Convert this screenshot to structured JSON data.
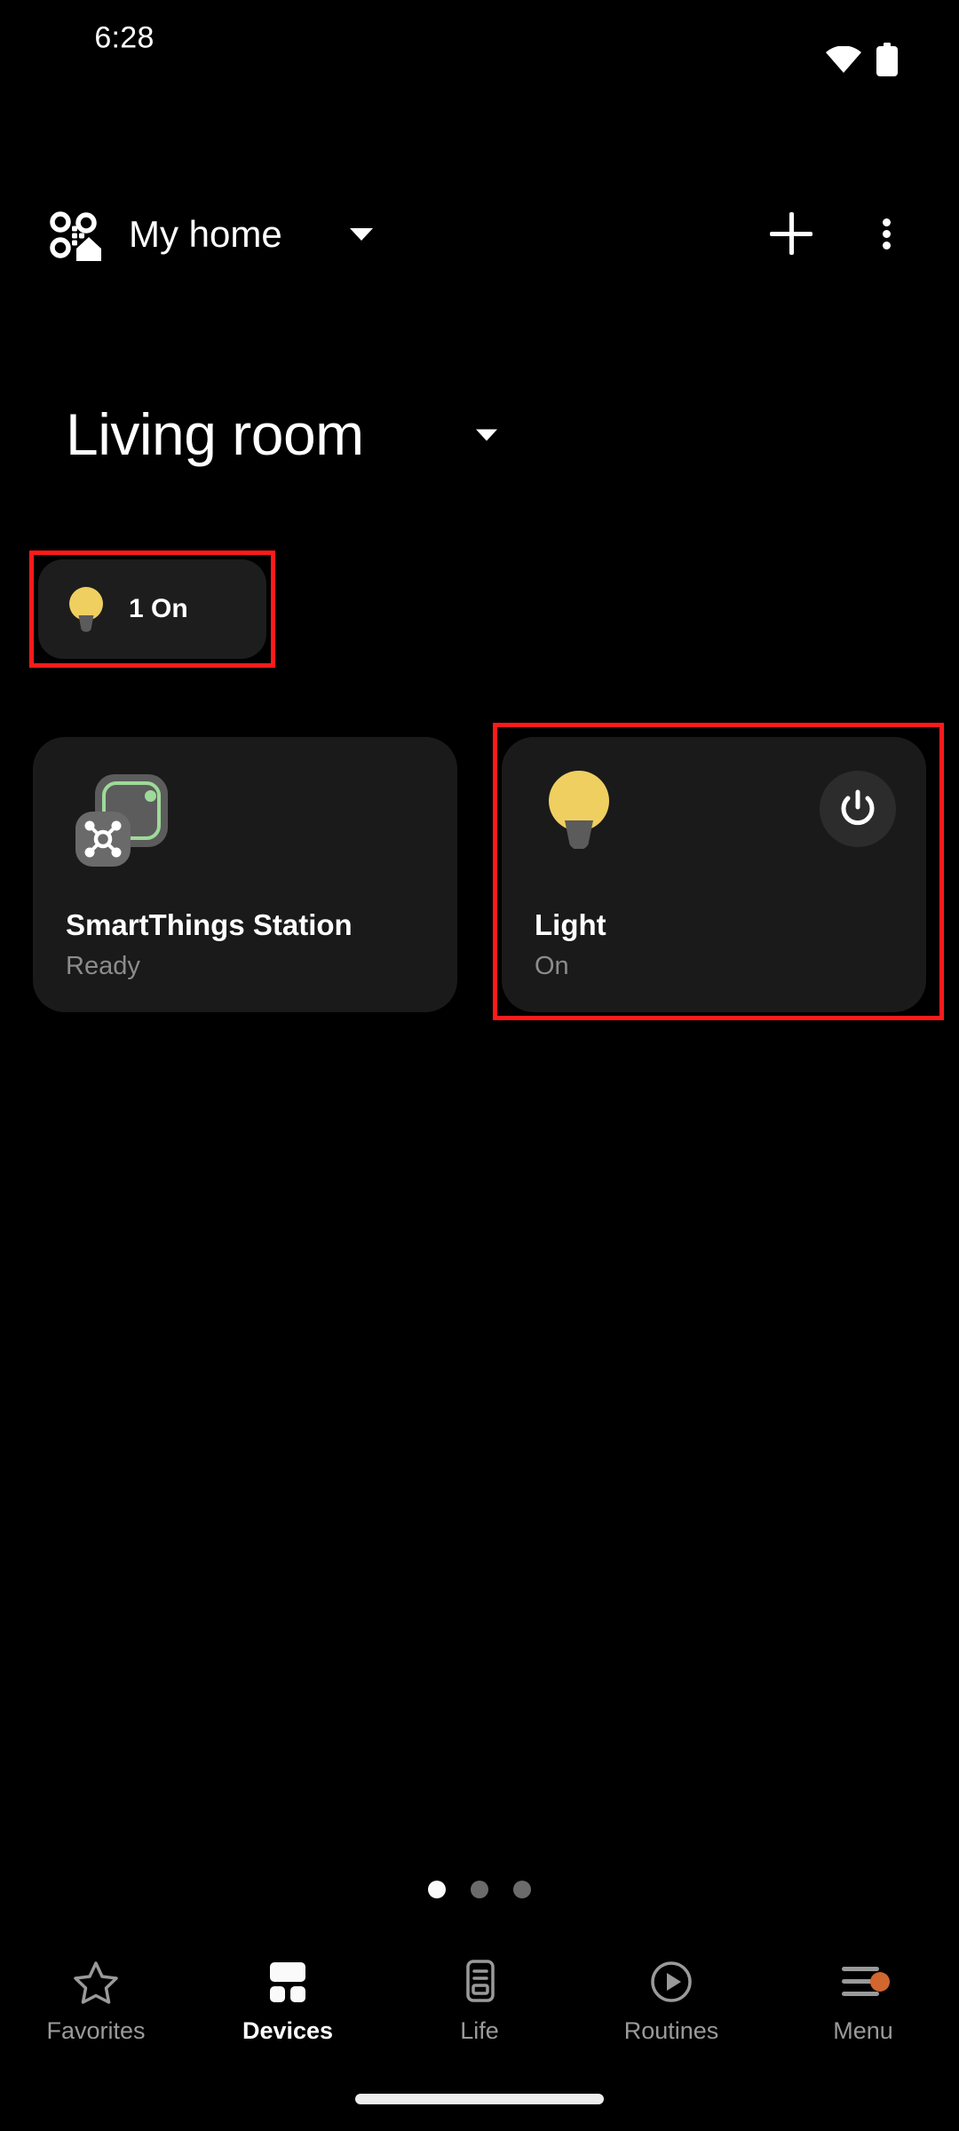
{
  "status_bar": {
    "time": "6:28",
    "icons": [
      "wifi-icon",
      "battery-icon"
    ]
  },
  "header": {
    "logo_icon": "smartthings-logo-icon",
    "home_name": "My home",
    "home_dropdown_icon": "chevron-down-icon",
    "add_icon": "plus-icon",
    "more_icon": "more-vertical-icon"
  },
  "room": {
    "name": "Living room",
    "dropdown_icon": "chevron-down-icon"
  },
  "status_chip": {
    "icon": "light-bulb-icon",
    "label": "1 On"
  },
  "devices": [
    {
      "name": "SmartThings Station",
      "status": "Ready",
      "icon": "smartthings-station-icon",
      "badge_icon": "hub-network-icon",
      "has_power_button": false
    },
    {
      "name": "Light",
      "status": "On",
      "icon": "light-bulb-icon",
      "power_icon": "power-icon",
      "has_power_button": true
    }
  ],
  "pagination": {
    "total": 3,
    "active_index": 0
  },
  "bottom_nav": {
    "items": [
      {
        "label": "Favorites",
        "icon": "star-outline-icon",
        "active": false,
        "badge": false
      },
      {
        "label": "Devices",
        "icon": "devices-grid-icon",
        "active": true,
        "badge": false
      },
      {
        "label": "Life",
        "icon": "life-card-icon",
        "active": false,
        "badge": false
      },
      {
        "label": "Routines",
        "icon": "play-circle-icon",
        "active": false,
        "badge": false
      },
      {
        "label": "Menu",
        "icon": "hamburger-icon",
        "active": false,
        "badge": true
      }
    ]
  },
  "colors": {
    "background": "#000000",
    "card": "#1A1A1A",
    "chip": "#1D1D1D",
    "bulb_yellow": "#EFCF60",
    "bulb_base_gray": "#5B5B5B",
    "station_green": "#9EDA98",
    "station_gray": "#5C5C5C",
    "annotation_red": "#FF1A1A",
    "badge_orange": "#D1662F",
    "text_primary": "#FFFFFF",
    "text_secondary": "#8C8C8C",
    "nav_inactive": "#9A9A9A"
  }
}
